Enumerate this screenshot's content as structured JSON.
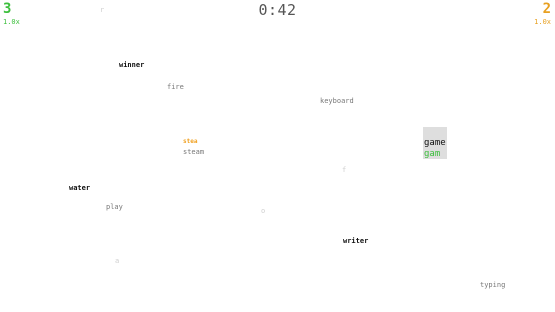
{
  "hud": {
    "player1": {
      "score": "3",
      "multiplier": "1.0x",
      "color": "#3cbf3c"
    },
    "player2": {
      "score": "2",
      "multiplier": "1.0x",
      "color": "#e8a020"
    },
    "timer": "0:42"
  },
  "words": {
    "faint_top": "r",
    "winner": "winner",
    "fire": "fire",
    "keyboard": "keyboard",
    "steam_typed": "stea",
    "steam": "steam",
    "f_faint": "f",
    "water": "water",
    "play": "play",
    "o_faint": "o",
    "writer": "writer",
    "a_faint": "a",
    "typing": "typing"
  },
  "active": {
    "word": "game",
    "typed": "gam"
  }
}
